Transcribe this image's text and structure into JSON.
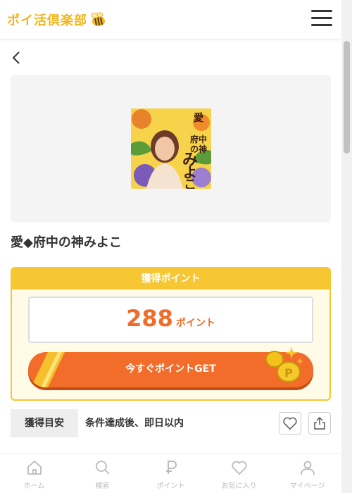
{
  "header": {
    "logo_text": "ポイ活倶楽部",
    "menu_icon": "hamburger-icon"
  },
  "offer": {
    "title": "愛◆府中の神みよこ",
    "thumbnail_text": "愛府中の神みよこ"
  },
  "points": {
    "heading": "獲得ポイント",
    "value": "288",
    "unit": "ポイント",
    "get_button_label": "今すぐポイントGET"
  },
  "estimate": {
    "label": "獲得目安",
    "value": "条件達成後、即日以内"
  },
  "actions": {
    "favorite_icon": "heart-icon",
    "share_icon": "share-icon"
  },
  "bottom_nav": [
    {
      "label": "ホーム",
      "icon": "home-icon"
    },
    {
      "label": "検索",
      "icon": "search-icon"
    },
    {
      "label": "ポイント",
      "icon": "point-icon"
    },
    {
      "label": "お気に入り",
      "icon": "heart-icon"
    },
    {
      "label": "マイページ",
      "icon": "user-icon"
    }
  ],
  "colors": {
    "brand_yellow": "#f7c633",
    "accent_orange": "#f26c2a",
    "points_text": "#ef6c2b"
  }
}
